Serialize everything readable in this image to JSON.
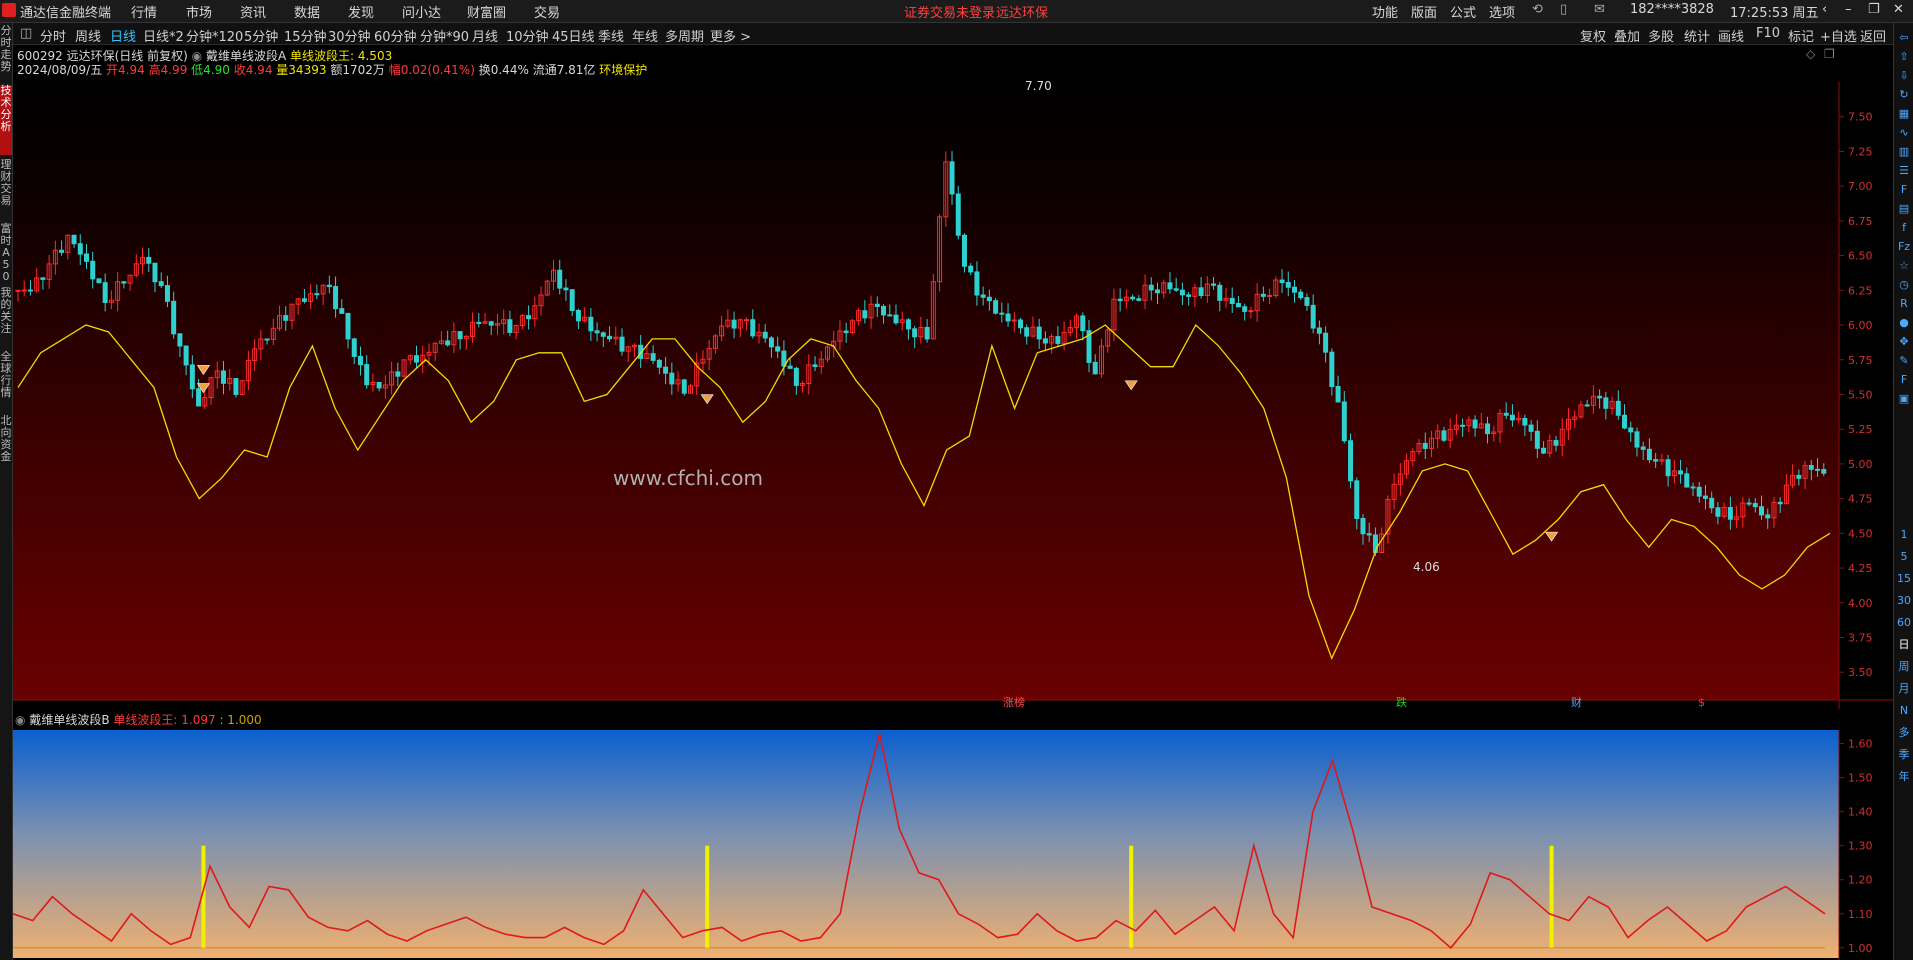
{
  "menubar": {
    "app_title": "通达信金融终端",
    "items": [
      "行情",
      "市场",
      "资讯",
      "数据",
      "发现",
      "问小达",
      "财富圈",
      "交易"
    ],
    "warning": "证券交易未登录",
    "stock_name": "远达环保",
    "right_items": [
      "功能",
      "版面",
      "公式",
      "选项"
    ],
    "account": "182****3828",
    "clock": "17:25:53 周五"
  },
  "toolbar": {
    "periods": [
      "分时",
      "周线",
      "日线",
      "日线*2",
      "分钟*120",
      "5分钟",
      "15分钟",
      "30分钟",
      "60分钟",
      "分钟*90",
      "月线",
      "10分钟",
      "45日线",
      "季线",
      "年线",
      "多周期",
      "更多 >"
    ],
    "active": "日线",
    "right": [
      "复权",
      "叠加",
      "多股",
      "统计",
      "画线",
      "F10",
      "标记",
      "+自选",
      "返回"
    ]
  },
  "left_tabs": [
    "分时走势",
    "技术分析",
    "理财交易",
    "富时A50",
    "我的关注",
    "全球行情",
    "北向资金"
  ],
  "right_icons": [
    "arrow-left-icon",
    "arrow-up-icon",
    "arrow-down-icon",
    "refresh-icon",
    "grid-icon",
    "line-icon",
    "bar-icon",
    "list-icon",
    "fa-icon",
    "doc-icon",
    "f-icon",
    "fz-icon",
    "star-icon",
    "clock-icon",
    "rsi-icon",
    "drop-icon",
    "move-icon",
    "pencil-icon",
    "f5-icon",
    "chart-icon"
  ],
  "right_period_labels": [
    "1",
    "5",
    "15",
    "30",
    "60",
    "日",
    "周",
    "月",
    "N",
    "多",
    "季",
    "年"
  ],
  "main_panel": {
    "title_line": "600292 远达环保(日线 前复权)",
    "indicator_name": "戴维单线波段A",
    "indicator_value": "单线波段王: 4.503",
    "date": "2024/08/09/五",
    "open": "开4.94",
    "high": "高4.99",
    "low": "低4.90",
    "close": "收4.94",
    "volume": "量34393",
    "amount": "额1702万",
    "change": "幅0.02(0.41%)",
    "turnover": "换0.44%",
    "float_cap": "流通7.81亿",
    "sector": "环境保护",
    "high_marker": "7.70",
    "low_marker": "4.06",
    "watermark": "www.cfchi.com",
    "event_labels": [
      "涨榜",
      "跌",
      "财",
      "$"
    ]
  },
  "sub_panel": {
    "indicator_name": "戴维单线波段B",
    "indicator_value_label": "单线波段王:",
    "indicator_value": "1.097",
    "ref_value": ": 1.000"
  },
  "chart_data": [
    {
      "type": "line",
      "title": "",
      "y_ticks": [
        "7.50",
        "7.25",
        "7.00",
        "6.75",
        "6.50",
        "6.25",
        "6.00",
        "5.75",
        "5.50",
        "5.25",
        "5.00",
        "4.75",
        "4.50",
        "4.25",
        "4.00",
        "3.75",
        "3.50"
      ],
      "ylim": [
        3.3,
        7.75
      ],
      "series": [
        {
          "name": "收",
          "color": "#ff3030",
          "values": [
            6.25,
            6.4,
            6.6,
            6.45,
            6.2,
            6.35,
            6.5,
            6.25,
            5.8,
            5.4,
            5.7,
            5.55,
            5.85,
            5.95,
            6.1,
            6.2,
            6.3,
            5.95,
            5.6,
            5.55,
            5.7,
            5.75,
            5.9,
            5.95,
            6.05,
            6.0,
            5.95,
            6.1,
            6.4,
            6.15,
            6.0,
            5.9,
            5.8,
            5.75,
            5.65,
            5.55,
            5.8,
            6.0,
            6.0,
            5.9,
            5.8,
            5.6,
            5.75,
            5.9,
            6.0,
            6.1,
            6.05,
            6.0,
            5.95,
            7.2,
            6.4,
            6.15,
            6.05,
            6.0,
            5.95,
            5.9,
            6.05,
            5.6,
            6.15,
            6.2,
            6.3,
            6.3,
            6.2,
            6.25,
            6.15,
            6.1,
            6.25,
            6.35,
            6.2,
            5.9,
            5.4,
            4.6,
            4.4,
            4.9,
            5.1,
            5.15,
            5.2,
            5.3,
            5.25,
            5.4,
            5.3,
            5.05,
            5.2,
            5.4,
            5.5,
            5.4,
            5.15,
            5.0,
            4.9,
            4.8,
            4.7,
            4.65,
            4.75,
            4.6,
            4.8,
            4.95,
            4.94
          ]
        },
        {
          "name": "单线波段王",
          "color": "#f0dc00",
          "values": [
            5.55,
            5.8,
            5.9,
            6.0,
            5.95,
            5.75,
            5.55,
            5.05,
            4.75,
            4.9,
            5.1,
            5.05,
            5.55,
            5.85,
            5.4,
            5.1,
            5.35,
            5.6,
            5.75,
            5.6,
            5.3,
            5.45,
            5.75,
            5.8,
            5.8,
            5.45,
            5.5,
            5.7,
            5.9,
            5.9,
            5.7,
            5.55,
            5.3,
            5.45,
            5.75,
            5.9,
            5.85,
            5.6,
            5.4,
            5.0,
            4.7,
            5.1,
            5.2,
            5.85,
            5.4,
            5.8,
            5.85,
            5.9,
            6.0,
            5.85,
            5.7,
            5.7,
            6.0,
            5.85,
            5.65,
            5.4,
            4.9,
            4.05,
            3.6,
            3.95,
            4.4,
            4.65,
            4.95,
            5.0,
            4.95,
            4.65,
            4.35,
            4.45,
            4.6,
            4.8,
            4.85,
            4.6,
            4.4,
            4.6,
            4.55,
            4.4,
            4.2,
            4.1,
            4.2,
            4.4,
            4.5
          ]
        }
      ]
    },
    {
      "type": "line",
      "title": "",
      "y_ticks": [
        "1.60",
        "1.50",
        "1.40",
        "1.30",
        "1.20",
        "1.10",
        "1.00"
      ],
      "ylim": [
        0.97,
        1.64
      ],
      "series": [
        {
          "name": "单线波段王",
          "color": "#e02020",
          "values": [
            1.1,
            1.08,
            1.15,
            1.1,
            1.06,
            1.02,
            1.1,
            1.05,
            1.01,
            1.03,
            1.24,
            1.12,
            1.06,
            1.18,
            1.17,
            1.09,
            1.06,
            1.05,
            1.08,
            1.04,
            1.02,
            1.05,
            1.07,
            1.09,
            1.06,
            1.04,
            1.03,
            1.03,
            1.06,
            1.03,
            1.01,
            1.05,
            1.17,
            1.1,
            1.03,
            1.05,
            1.06,
            1.02,
            1.04,
            1.05,
            1.02,
            1.03,
            1.1,
            1.4,
            1.63,
            1.35,
            1.22,
            1.2,
            1.1,
            1.07,
            1.03,
            1.04,
            1.1,
            1.05,
            1.02,
            1.03,
            1.08,
            1.05,
            1.11,
            1.04,
            1.08,
            1.12,
            1.05,
            1.3,
            1.1,
            1.03,
            1.4,
            1.55,
            1.35,
            1.12,
            1.1,
            1.08,
            1.05,
            1.0,
            1.07,
            1.22,
            1.2,
            1.15,
            1.1,
            1.08,
            1.15,
            1.12,
            1.03,
            1.08,
            1.12,
            1.07,
            1.02,
            1.05,
            1.12,
            1.15,
            1.18,
            1.14,
            1.1
          ]
        },
        {
          "name": "1.000",
          "color": "#c8a000",
          "values": [
            1.0
          ]
        }
      ]
    }
  ]
}
